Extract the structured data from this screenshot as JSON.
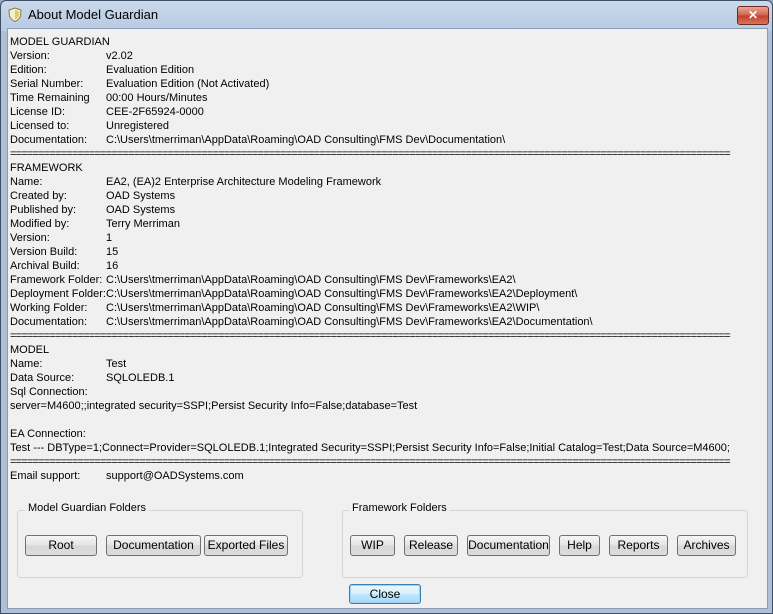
{
  "window": {
    "title": "About Model Guardian",
    "close_glyph": "✕"
  },
  "model_guardian": {
    "heading": "MODEL GUARDIAN",
    "fields": [
      {
        "label": "Version:",
        "value": "v2.02"
      },
      {
        "label": "Edition:",
        "value": "Evaluation Edition"
      },
      {
        "label": "Serial Number:",
        "value": "Evaluation Edition (Not Activated)"
      },
      {
        "label": "Time Remaining",
        "value": "00:00 Hours/Minutes"
      },
      {
        "label": "License ID:",
        "value": "CEE-2F65924-0000"
      },
      {
        "label": "Licensed to:",
        "value": "Unregistered"
      },
      {
        "label": "Documentation:",
        "value": "C:\\Users\\tmerriman\\AppData\\Roaming\\OAD Consulting\\FMS Dev\\Documentation\\"
      }
    ]
  },
  "separator": "================================================================================================================================",
  "framework": {
    "heading": "FRAMEWORK",
    "fields": [
      {
        "label": "Name:",
        "value": "EA2, (EA)2 Enterprise Architecture Modeling Framework"
      },
      {
        "label": "Created by:",
        "value": "OAD Systems"
      },
      {
        "label": "Published by:",
        "value": "OAD Systems"
      },
      {
        "label": "Modified by:",
        "value": "Terry Merriman"
      },
      {
        "label": "Version:",
        "value": "1"
      },
      {
        "label": "Version Build:",
        "value": "15"
      },
      {
        "label": "Archival Build:",
        "value": "16"
      },
      {
        "label": "Framework Folder:",
        "value": "C:\\Users\\tmerriman\\AppData\\Roaming\\OAD Consulting\\FMS Dev\\Frameworks\\EA2\\"
      },
      {
        "label": "Deployment Folder:",
        "value": "C:\\Users\\tmerriman\\AppData\\Roaming\\OAD Consulting\\FMS Dev\\Frameworks\\EA2\\Deployment\\"
      },
      {
        "label": "Working Folder:",
        "value": "C:\\Users\\tmerriman\\AppData\\Roaming\\OAD Consulting\\FMS Dev\\Frameworks\\EA2\\WIP\\"
      },
      {
        "label": "Documentation:",
        "value": "C:\\Users\\tmerriman\\AppData\\Roaming\\OAD Consulting\\FMS Dev\\Frameworks\\EA2\\Documentation\\"
      }
    ]
  },
  "model": {
    "heading": "MODEL",
    "name_label": "Name:",
    "name_value": "Test",
    "source_label": "Data Source:",
    "source_value": "SQLOLEDB.1",
    "sql_label": "Sql Connection:",
    "sql_value": "server=M4600;;integrated security=SSPI;Persist Security Info=False;database=Test",
    "ea_label": "EA Connection:",
    "ea_value": "Test --- DBType=1;Connect=Provider=SQLOLEDB.1;Integrated Security=SSPI;Persist Security Info=False;Initial Catalog=Test;Data Source=M4600;"
  },
  "support": {
    "label": "Email support:",
    "value": "support@OADSystems.com"
  },
  "mg_folders": {
    "title": "Model Guardian Folders",
    "buttons": [
      "Root",
      "Documentation",
      "Exported Files"
    ]
  },
  "fw_folders": {
    "title": "Framework Folders",
    "buttons": [
      "WIP",
      "Release",
      "Documentation",
      "Help",
      "Reports",
      "Archives"
    ]
  },
  "close_button": "Close"
}
